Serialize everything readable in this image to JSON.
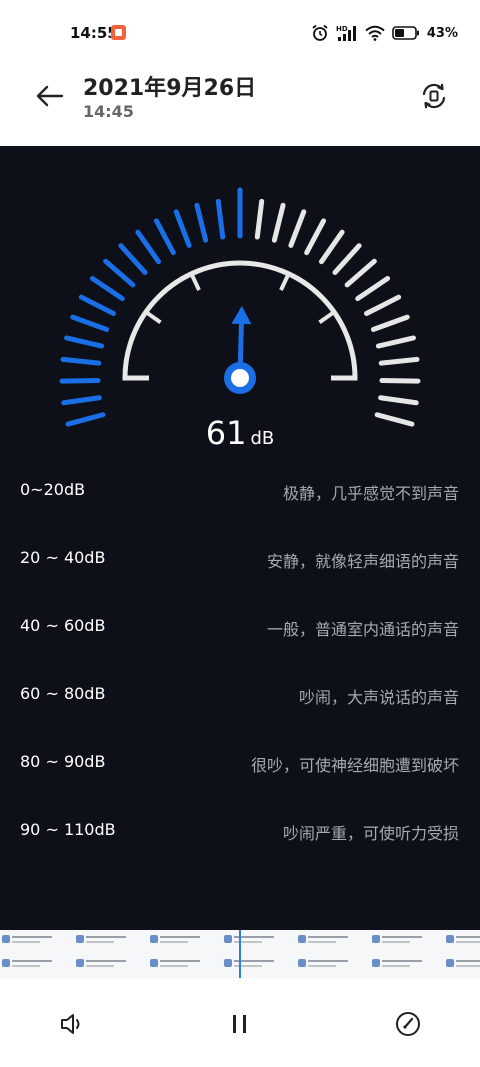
{
  "status_bar": {
    "time": "14:55",
    "battery_percent": "43%",
    "network_label": "HD",
    "icons": [
      "recording-icon",
      "alarm-icon",
      "hd-signal-icon",
      "wifi-icon",
      "battery-icon"
    ]
  },
  "header": {
    "date": "2021年9月26日",
    "time": "14:45",
    "back_icon": "arrow-left-icon",
    "rotate_icon": "screen-rotate-icon"
  },
  "meter": {
    "value": "61",
    "unit": "dB",
    "level_db": 61,
    "max_db": 120,
    "active_color": "#1a6fe6",
    "inactive_color": "#e6e6e6"
  },
  "levels": [
    {
      "range": "0~20dB",
      "description": "极静，几乎感觉不到声音"
    },
    {
      "range": "20 ~ 40dB",
      "description": "安静，就像轻声细语的声音"
    },
    {
      "range": "40 ~ 60dB",
      "description": "一般，普通室内通话的声音"
    },
    {
      "range": "60 ~ 80dB",
      "description": "吵闹，大声说话的声音"
    },
    {
      "range": "80 ~ 90dB",
      "description": "很吵，可使神经细胞遭到破坏"
    },
    {
      "range": "90 ~ 110dB",
      "description": "吵闹严重，可使听力受损"
    }
  ],
  "bottom_bar": {
    "speaker_icon": "speaker-icon",
    "pause_icon": "pause-icon",
    "gauge_icon": "gauge-icon"
  },
  "colors": {
    "panel_bg": "#0d1018",
    "accent": "#1a6fe6",
    "text_secondary": "#a5a9b0"
  }
}
